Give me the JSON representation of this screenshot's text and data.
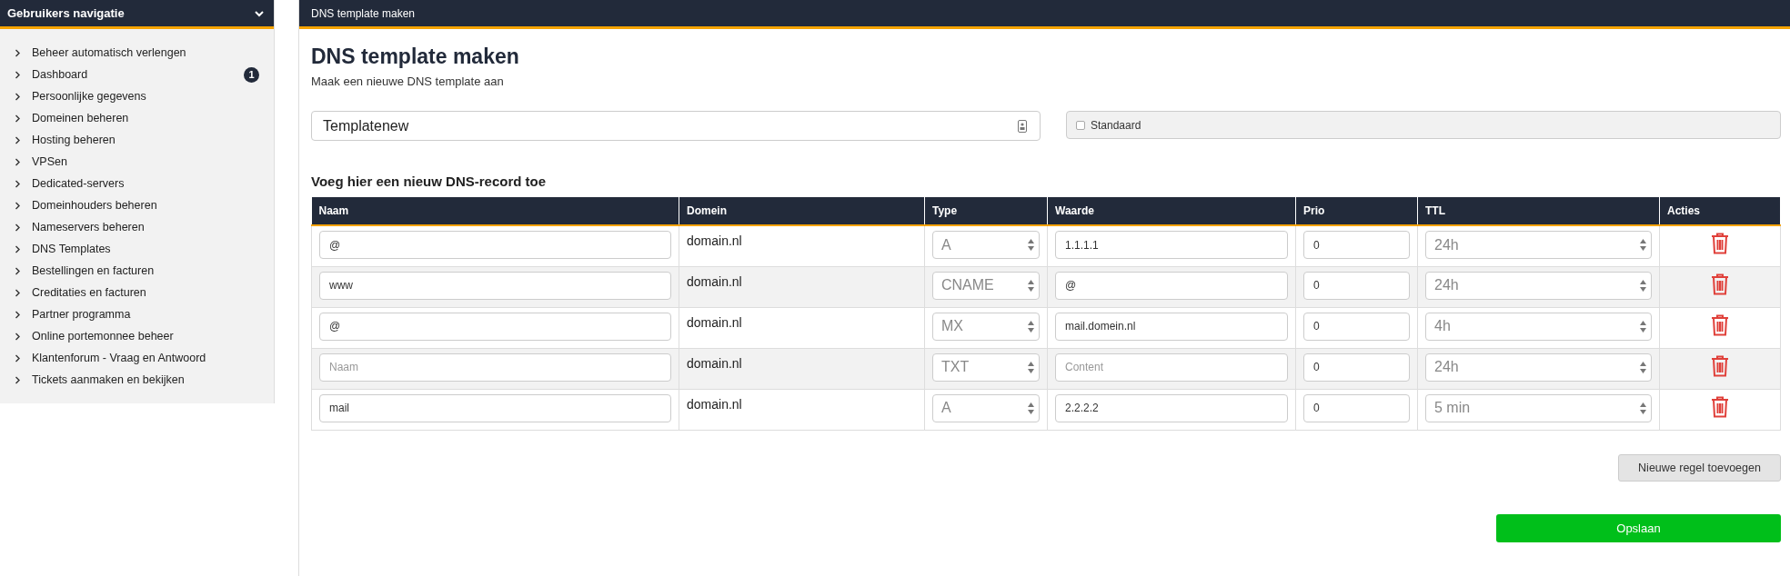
{
  "sidebar": {
    "title": "Gebruikers navigatie",
    "expanded": true,
    "items": [
      {
        "label": "Beheer automatisch verlengen"
      },
      {
        "label": "Dashboard",
        "badge": "1"
      },
      {
        "label": "Persoonlijke gegevens"
      },
      {
        "label": "Domeinen beheren"
      },
      {
        "label": "Hosting beheren"
      },
      {
        "label": "VPSen"
      },
      {
        "label": "Dedicated-servers"
      },
      {
        "label": "Domeinhouders beheren"
      },
      {
        "label": "Nameservers beheren"
      },
      {
        "label": "DNS Templates"
      },
      {
        "label": "Bestellingen en facturen"
      },
      {
        "label": "Creditaties en facturen"
      },
      {
        "label": "Partner programma"
      },
      {
        "label": "Online portemonnee beheer"
      },
      {
        "label": "Klantenforum - Vraag en Antwoord"
      },
      {
        "label": "Tickets aanmaken en bekijken"
      }
    ]
  },
  "header": {
    "title": "DNS template maken"
  },
  "page": {
    "title": "DNS template maken",
    "subtitle": "Maak een nieuwe DNS template aan"
  },
  "template_name": {
    "value": "Templatenew"
  },
  "default_checkbox": {
    "label": "Standaard",
    "checked": false
  },
  "records_title": "Voeg hier een nieuw DNS-record toe",
  "table": {
    "columns": [
      "Naam",
      "Domein",
      "Type",
      "Waarde",
      "Prio",
      "TTL",
      "Acties"
    ],
    "rows": [
      {
        "name": {
          "value": "@"
        },
        "domain": "domain.nl",
        "type": "A",
        "content": {
          "value": "1.1.1.1"
        },
        "prio": "0",
        "ttl": "24h"
      },
      {
        "name": {
          "value": "www"
        },
        "domain": "domain.nl",
        "type": "CNAME",
        "content": {
          "value": "@"
        },
        "prio": "0",
        "ttl": "24h"
      },
      {
        "name": {
          "value": "@"
        },
        "domain": "domain.nl",
        "type": "MX",
        "content": {
          "value": "mail.domein.nl"
        },
        "prio": "0",
        "ttl": "4h"
      },
      {
        "name": {
          "placeholder": "Naam"
        },
        "domain": "domain.nl",
        "type": "TXT",
        "content": {
          "placeholder": "Content"
        },
        "prio": "0",
        "ttl": "24h"
      },
      {
        "name": {
          "value": "mail"
        },
        "domain": "domain.nl",
        "type": "A",
        "content": {
          "value": "2.2.2.2"
        },
        "prio": "0",
        "ttl": "5 min"
      }
    ]
  },
  "buttons": {
    "add_row": "Nieuwe regel toevoegen",
    "save": "Opslaan"
  }
}
